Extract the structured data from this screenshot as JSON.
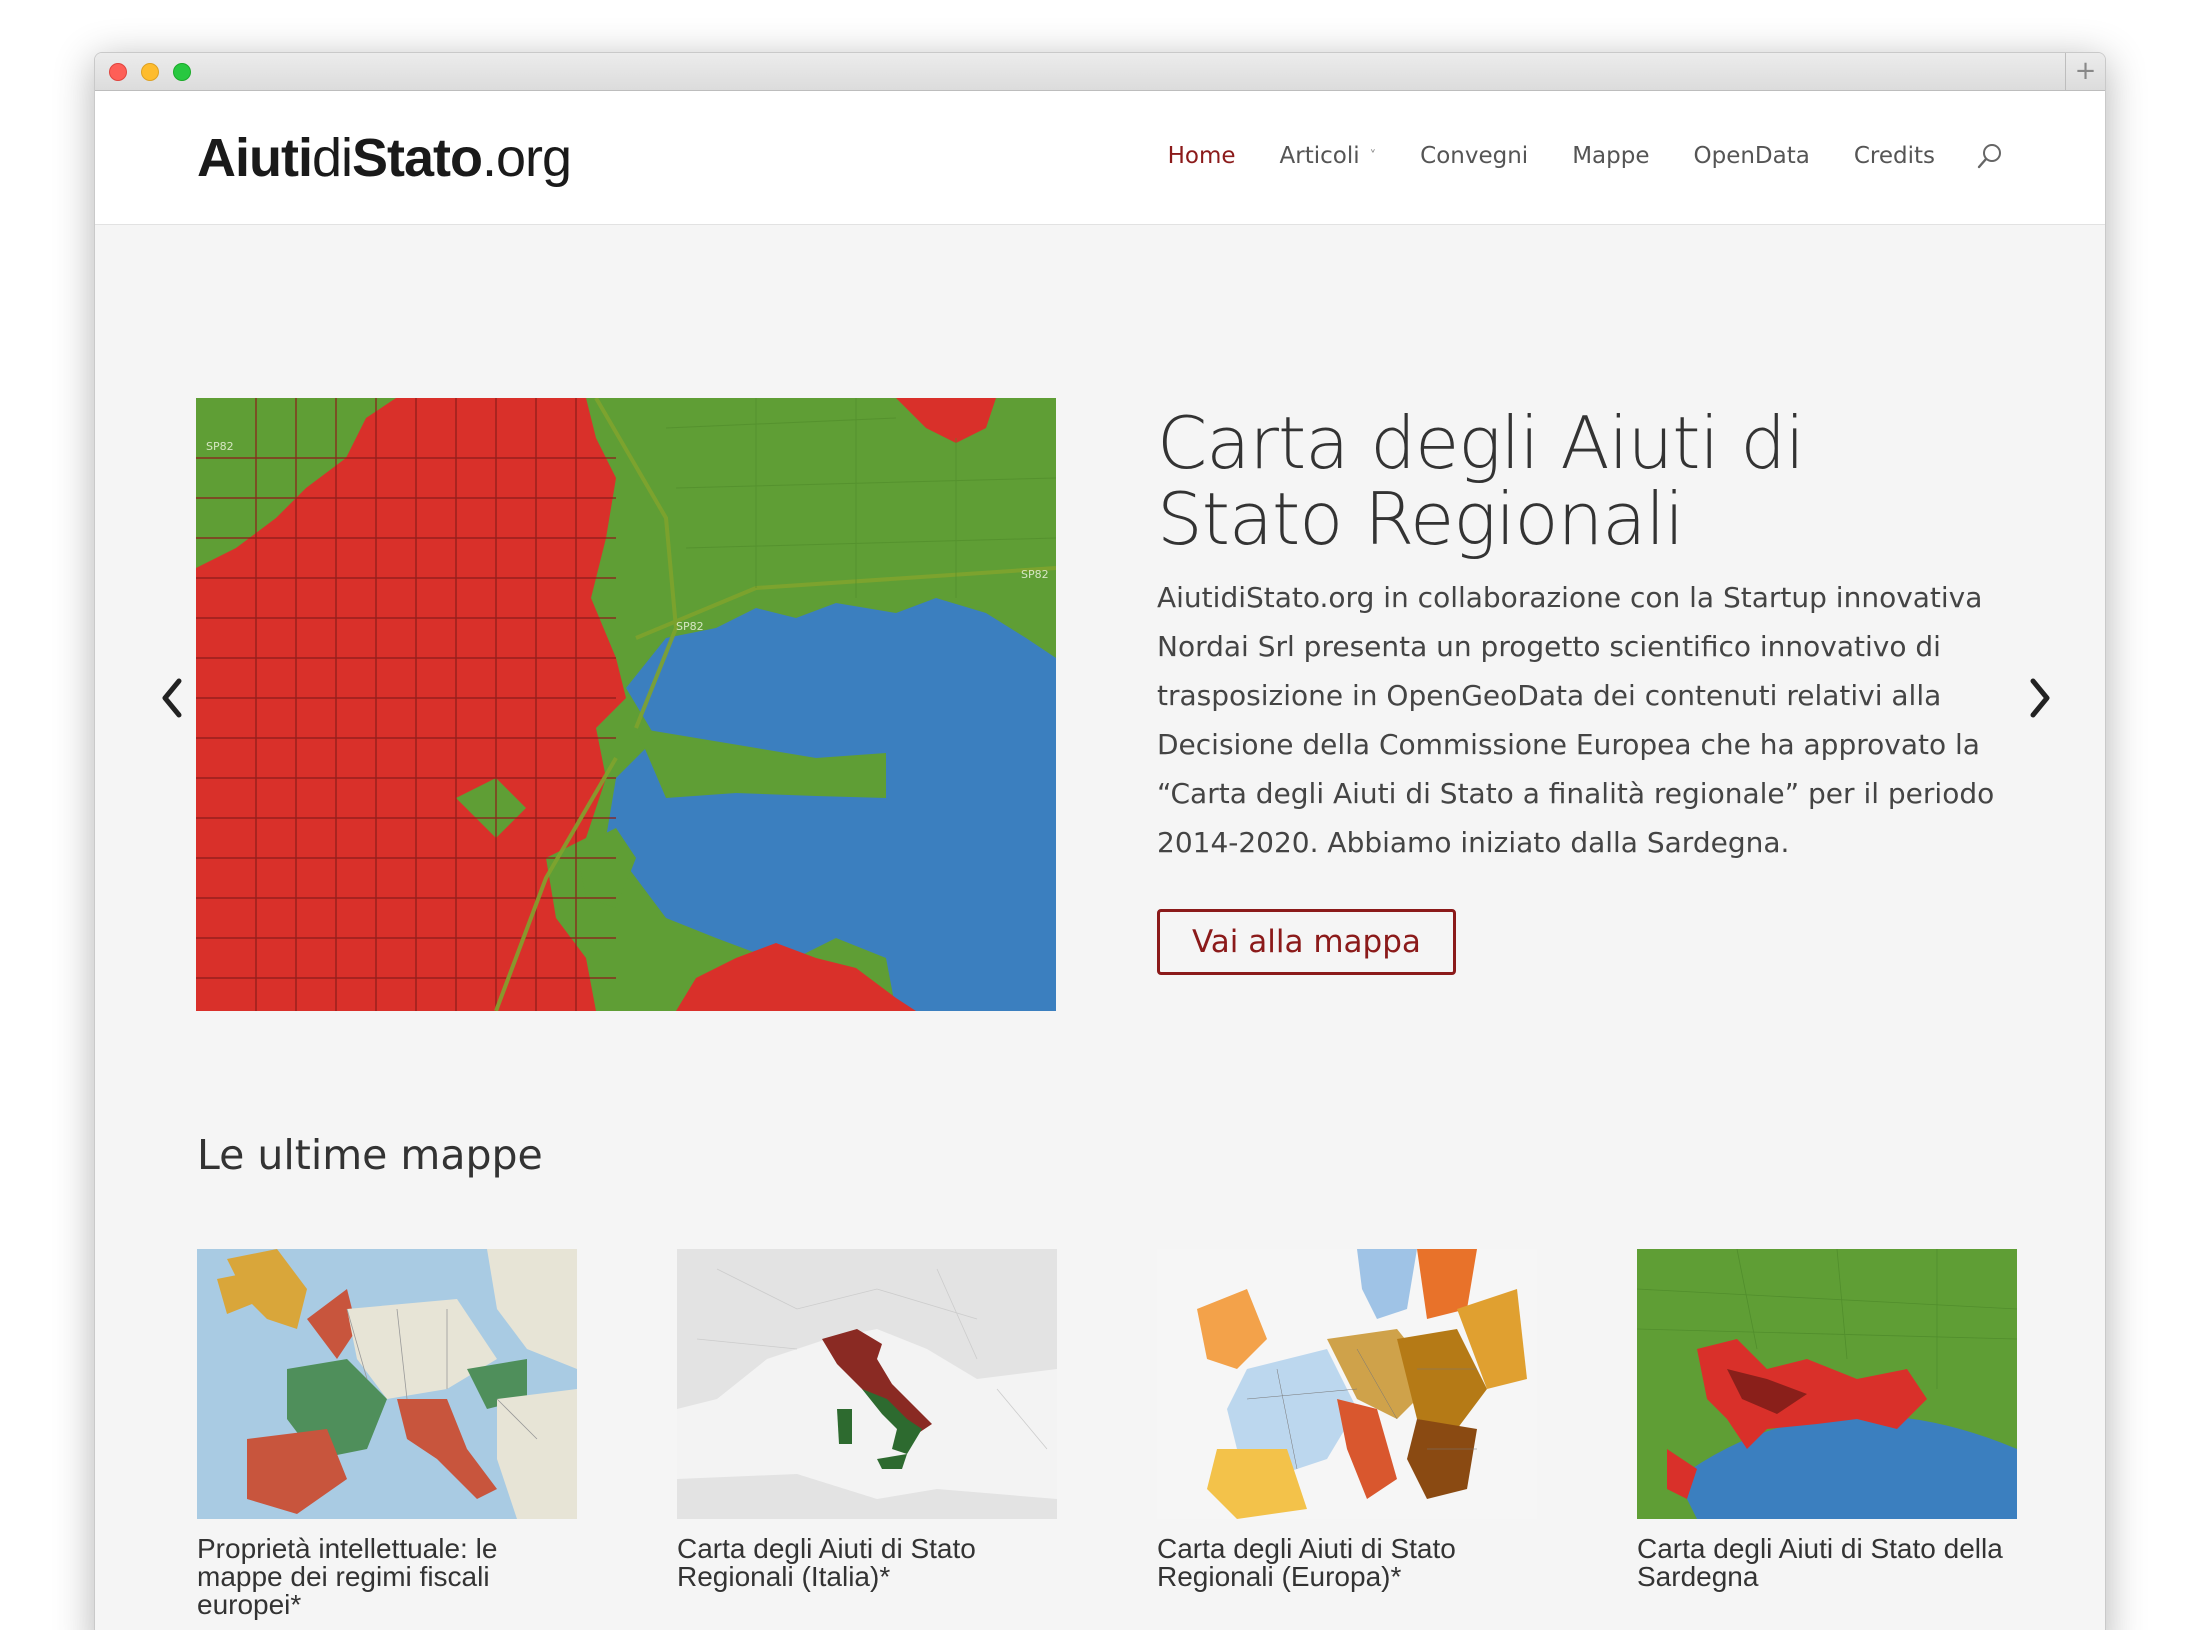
{
  "browser": {
    "newtab_label": "+"
  },
  "site": {
    "logo_bold": "Aiuti",
    "logo_middle": "di",
    "logo_bold2": "Stato",
    "logo_tld": ".org"
  },
  "nav": {
    "items": [
      {
        "label": "Home",
        "active": true
      },
      {
        "label": "Articoli",
        "has_dropdown": true,
        "chevron": "˅"
      },
      {
        "label": "Convegni"
      },
      {
        "label": "Mappe"
      },
      {
        "label": "OpenData"
      },
      {
        "label": "Credits"
      }
    ],
    "search_icon": "search-icon"
  },
  "hero": {
    "title": "Carta degli Aiuti di Stato Regionali",
    "description": "AiutidiStato.org in collaborazione con la Startup innovativa Nordai Srl presenta un progetto scientifico innovativo di trasposizione in OpenGeoData dei contenuti relativi alla Decisione della Commissione Europea che ha approvato la “Carta degli Aiuti di Stato a finalità regionale” per il periodo 2014-2020. Abbiamo iniziato dalla Sardegna.",
    "button_label": "Vai alla mappa",
    "map_labels": [
      "SP82",
      "SP82",
      "SP82"
    ]
  },
  "latest": {
    "title": "Le ultime mappe",
    "cards": [
      {
        "title": "Proprietà intellettuale: le mappe dei regimi fiscali europei*"
      },
      {
        "title": "Carta degli Aiuti di Stato Regionali (Italia)*"
      },
      {
        "title": "Carta degli Aiuti di Stato Regionali (Europa)*"
      },
      {
        "title": "Carta degli Aiuti di Stato della Sardegna"
      }
    ]
  },
  "colors": {
    "accent": "#8b1a1a",
    "map_red": "#d9302a",
    "map_green": "#5f9e35",
    "map_blue": "#3b7fbf"
  }
}
